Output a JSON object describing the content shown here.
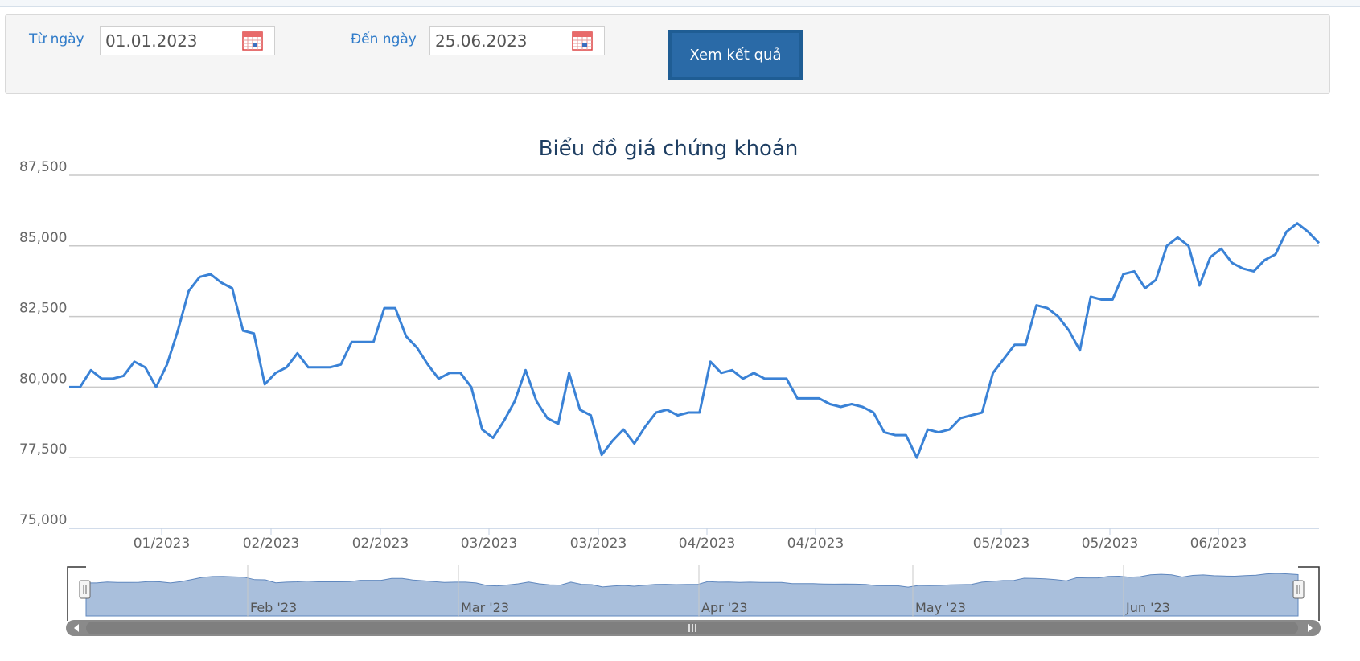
{
  "filter": {
    "from_label": "Từ ngày",
    "from_value": "01.01.2023",
    "to_label": "Đến ngày",
    "to_value": "25.06.2023",
    "submit_label": "Xem kết quả"
  },
  "colors": {
    "line": "#3a82d6",
    "navigator_fill": "#a9bfdc",
    "navigator_line": "#5f87be",
    "grid": "#c9c9c9",
    "title": "#1f3f63",
    "button": "#1f5d94"
  },
  "chart_data": {
    "type": "line",
    "title": "Biểu đồ giá chứng khoán",
    "ylim": [
      75000,
      87500
    ],
    "y_ticks": [
      75000,
      77500,
      80000,
      82500,
      85000,
      87500
    ],
    "y_tick_labels": [
      "75,000",
      "77,500",
      "80,000",
      "82,500",
      "85,000",
      "87,500"
    ],
    "x_tick_labels": [
      "01/2023",
      "02/2023",
      "02/2023",
      "03/2023",
      "03/2023",
      "04/2023",
      "04/2023",
      "05/2023",
      "05/2023",
      "06/2023"
    ],
    "grid": true,
    "series": [
      {
        "values": [
          80000,
          80000,
          80600,
          80300,
          80300,
          80400,
          80900,
          80700,
          80000,
          80800,
          82000,
          83400,
          83900,
          84000,
          83700,
          83500,
          82000,
          81900,
          80100,
          80500,
          80700,
          81200,
          80700,
          80700,
          80700,
          80800,
          81600,
          81600,
          81600,
          82800,
          82800,
          81800,
          81400,
          80800,
          80300,
          80500,
          80500,
          80000,
          78500,
          78200,
          78800,
          79500,
          80600,
          79500,
          78900,
          78700,
          80500,
          79200,
          79000,
          77600,
          78100,
          78500,
          78000,
          78600,
          79100,
          79200,
          79000,
          79100,
          79100,
          80900,
          80500,
          80600,
          80300,
          80500,
          80300,
          80300,
          80300,
          79600,
          79600,
          79600,
          79400,
          79300,
          79400,
          79300,
          79100,
          78400,
          78300,
          78300,
          77500,
          78500,
          78400,
          78500,
          78900,
          79000,
          79100,
          80500,
          81000,
          81500,
          81500,
          82900,
          82800,
          82500,
          82000,
          81300,
          83200,
          83100,
          83100,
          84000,
          84100,
          83500,
          83800,
          85000,
          85300,
          85000,
          83600,
          84600,
          84900,
          84400,
          84200,
          84100,
          84500,
          84700,
          85500,
          85800,
          85500,
          85100
        ]
      }
    ],
    "navigator": {
      "labels": [
        "Feb '23",
        "Mar '23",
        "Apr '23",
        "May '23",
        "Jun '23"
      ]
    }
  }
}
